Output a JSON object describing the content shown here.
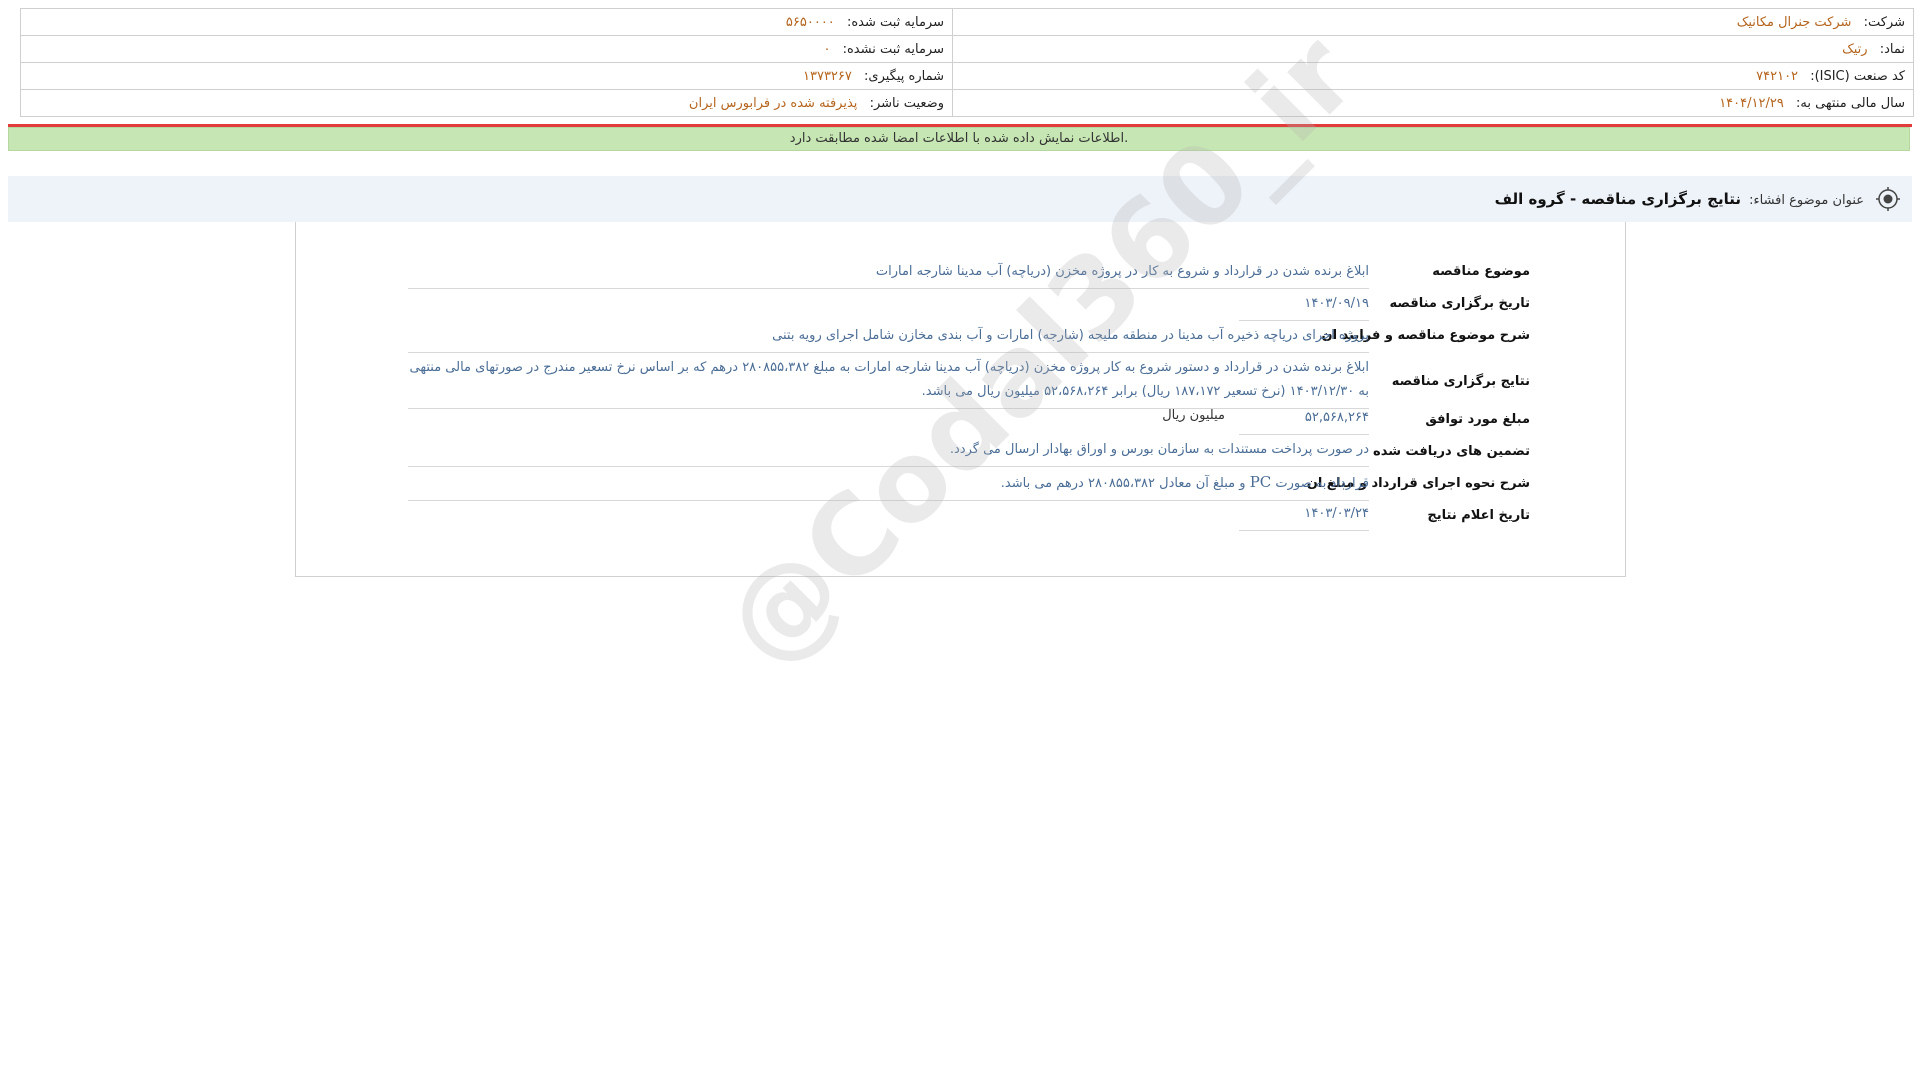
{
  "header": {
    "company_label": "شرکت:",
    "company_value": "شرکت جنرال مکانیک",
    "registered_capital_label": "سرمایه ثبت شده:",
    "registered_capital_value": "۵۶۵۰۰۰۰",
    "symbol_label": "نماد:",
    "symbol_value": "رتیک",
    "unregistered_capital_label": "سرمایه ثبت نشده:",
    "unregistered_capital_value": "۰",
    "isic_label": "کد صنعت (ISIC):",
    "isic_value": "۷۴۲۱۰۲",
    "tracking_label": "شماره پیگیری:",
    "tracking_value": "۱۳۷۳۲۶۷",
    "fiscal_year_label": "سال مالی منتهی به:",
    "fiscal_year_value": "۱۴۰۴/۱۲/۲۹",
    "publisher_status_label": "وضعیت ناشر:",
    "publisher_status_value": "پذیرفته شده در فرابورس ایران"
  },
  "notice": "اطلاعات نمایش داده شده با اطلاعات امضا شده مطابقت دارد.",
  "title": {
    "label": "عنوان موضوع افشاء:",
    "value": "نتایج برگزاری مناقصه - گروه الف"
  },
  "details": {
    "subject_label": "موضوع مناقصه",
    "subject_value": "ابلاغ برنده شدن در قرارداد و شروع به کار در پروژه مخزن (دریاچه) آب مدینا شارجه امارات",
    "date_label": "تاریخ برگزاری مناقصه",
    "date_value": "۱۴۰۳/۰۹/۱۹",
    "description_label": "شرح موضوع مناقصه و فرایند ان",
    "description_value": "پروژه اجرای دریاچه ذخیره آب مدینا در منطقه ملیحه (شارجه) امارات و آب بندی مخازن شامل اجرای رویه بتنی",
    "results_label": "نتایج برگزاری مناقصه",
    "results_value": "ابلاغ برنده شدن در قرارداد و دستور شروع به کار پروژه مخزن (دریاچه) آب مدینا شارجه امارات به مبلغ ۲۸۰۸۵۵،۳۸۲ درهم که بر اساس نرخ تسعیر مندرج در صورتهای مالی منتهی به ۱۴۰۳/۱۲/۳۰ (نرخ تسعیر ۱۸۷،۱۷۲ ریال) برابر ۵۲،۵۶۸،۲۶۴ میلیون ریال می باشد.",
    "amount_label": "مبلغ مورد توافق",
    "amount_value": "۵۲,۵۶۸,۲۶۴",
    "amount_unit": "میلیون ریال",
    "guarantees_label": "تضمین های دریافت شده",
    "guarantees_value": "در صورت پرداخت مستندات به سازمان بورس و اوراق بهادار ارسال می گردد.",
    "execution_label": "شرح نحوه اجرای قرارداد و مبلغ ان",
    "execution_value_pre": "قرارداد به صورت",
    "execution_value_pc": "PC",
    "execution_value_post": "و مبلغ آن معادل ۲۸۰۸۵۵،۳۸۲ درهم می باشد.",
    "announce_date_label": "تاریخ اعلام نتایج",
    "announce_date_value": "۱۴۰۳/۰۳/۲۴"
  },
  "watermark": "@Codal360_ir",
  "colors": {
    "value_orange": "#b5651d",
    "value_blue": "#4a6d96",
    "notice_green": "#c6e6b3",
    "alert_red": "#e23b3b",
    "title_bg": "#eef3fa"
  }
}
